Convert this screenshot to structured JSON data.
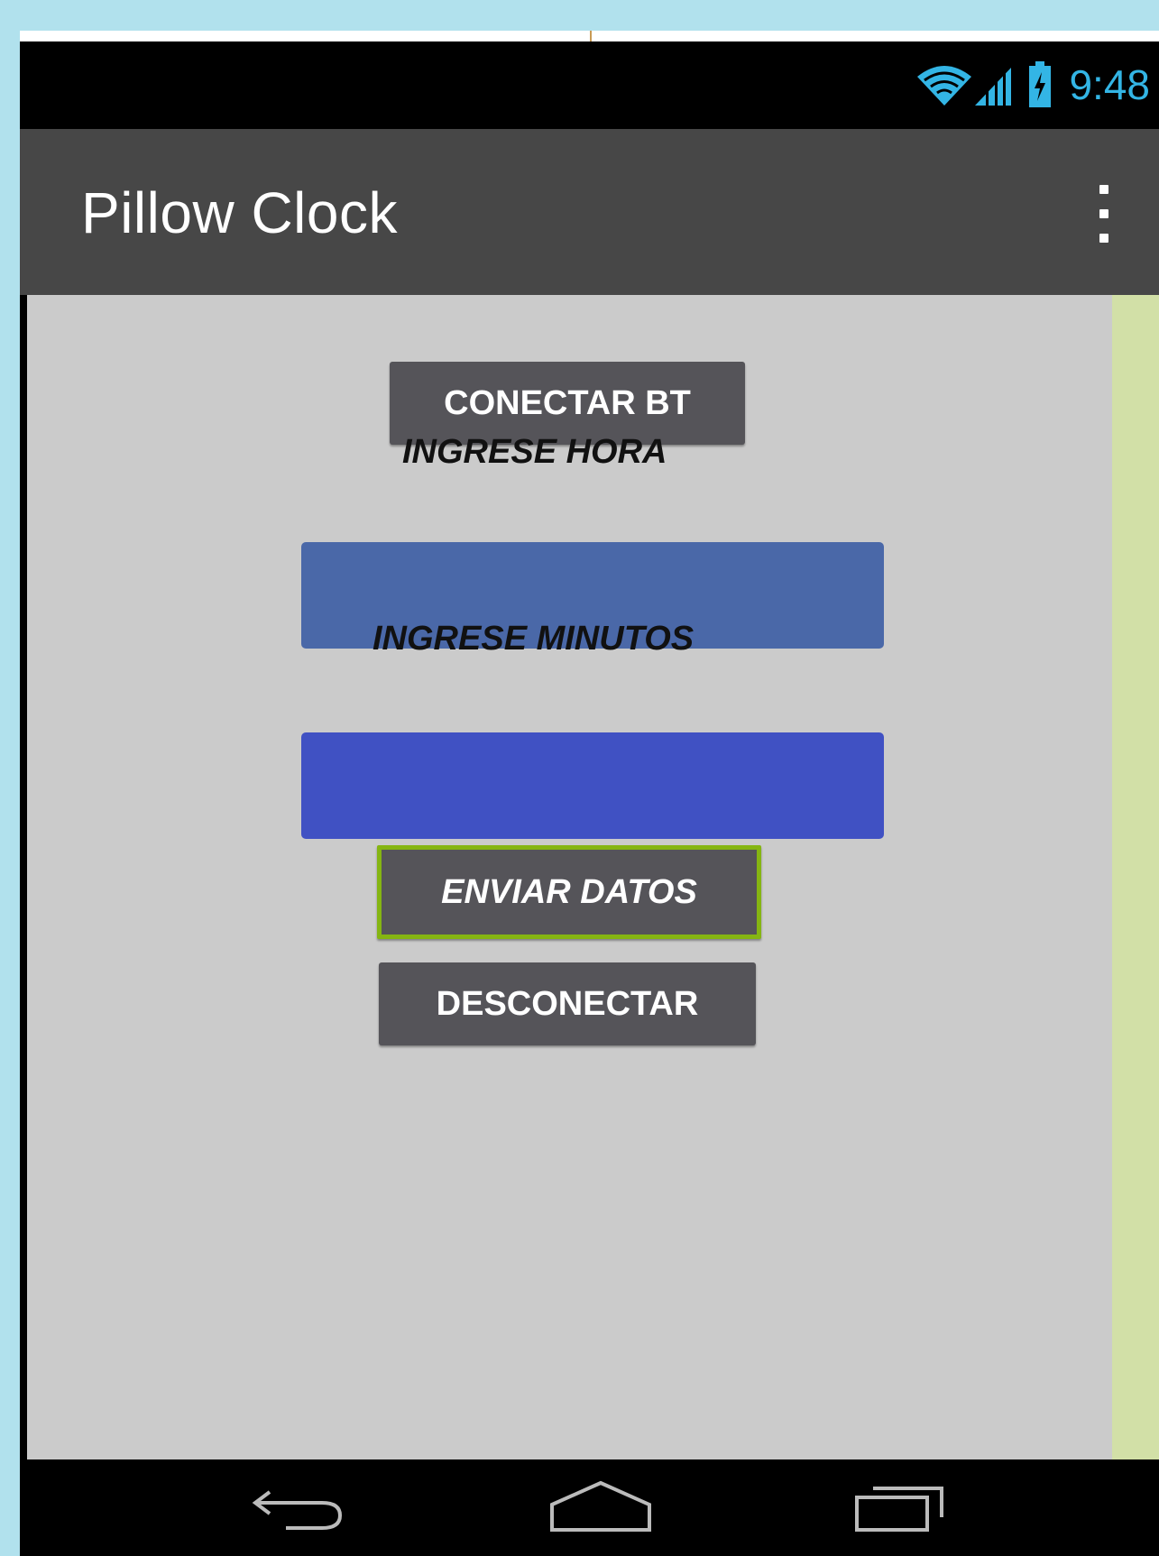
{
  "status_bar": {
    "time": "9:48",
    "icons": [
      "wifi-icon",
      "signal-icon",
      "battery-charging-icon"
    ],
    "accent_color": "#33b5e5"
  },
  "app_bar": {
    "title": "Pillow Clock",
    "menu_icon": "overflow-menu-icon"
  },
  "content": {
    "connect_button": "CONECTAR BT",
    "hour_label": "INGRESE HORA",
    "hour_input_value": "",
    "minutes_label": "INGRESE MINUTOS",
    "minutes_input_value": "",
    "send_button": "ENVIAR DATOS",
    "disconnect_button": "DESCONECTAR"
  },
  "nav_bar": {
    "icons": [
      "back-icon",
      "home-icon",
      "recent-apps-icon"
    ]
  },
  "colors": {
    "page_background": "#b1e1ed",
    "app_bar": "#474747",
    "content_background": "#cbcbcb",
    "button": "#555459",
    "hour_input": "#4a68a8",
    "minutes_input": "#4051c3",
    "send_button_border": "#85b512",
    "right_panel": "#d2e0a7"
  }
}
